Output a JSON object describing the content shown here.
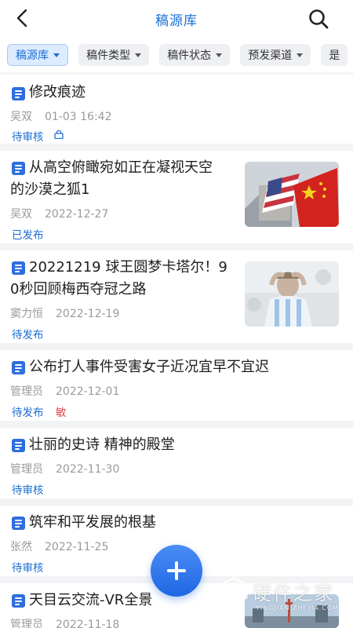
{
  "header": {
    "title": "稿源库"
  },
  "filters": [
    {
      "label": "稿源库",
      "active": true
    },
    {
      "label": "稿件类型",
      "active": false
    },
    {
      "label": "稿件状态",
      "active": false
    },
    {
      "label": "预发渠道",
      "active": false
    },
    {
      "label": "是",
      "active": false
    }
  ],
  "articles": [
    {
      "title_lines": [
        "修改痕迹"
      ],
      "author": "吴双",
      "date": "01-03 16:42",
      "status": "待审核",
      "lock": true
    },
    {
      "title_lines": [
        "从高空俯瞰宛如正在凝视天空",
        "的沙漠之狐1"
      ],
      "author": "吴双",
      "date": "2022-12-27",
      "status": "已发布",
      "thumb": "flags"
    },
    {
      "title_lines": [
        "20221219 球王圆梦卡塔尔！9",
        "0秒回顾梅西夺冠之路"
      ],
      "author": "窦力恒",
      "date": "2022-12-19",
      "status": "待发布",
      "thumb": "player"
    },
    {
      "title_lines": [
        "公布打人事件受害女子近况宜早不宜迟"
      ],
      "author": "管理员",
      "date": "2022-12-01",
      "status": "待发布",
      "sensitive": "敏"
    },
    {
      "title_lines": [
        "壮丽的史诗 精神的殿堂"
      ],
      "author": "管理员",
      "date": "2022-11-30",
      "status": "待审核"
    },
    {
      "title_lines": [
        "筑牢和平发展的根基"
      ],
      "author": "张然",
      "date": "2022-11-25",
      "status": "待审核"
    },
    {
      "title_lines": [
        "天目云交流-VR全景"
      ],
      "author": "管理员",
      "date": "2022-11-18",
      "status": "",
      "thumb": "tower"
    }
  ],
  "watermark": {
    "text": "硬件之家",
    "sub": "YINGJIAN ZHI JIA.COM"
  },
  "colors": {
    "accent": "#1a6fd6",
    "sensitive": "#e24b4b",
    "fab": "#2f74e8"
  }
}
